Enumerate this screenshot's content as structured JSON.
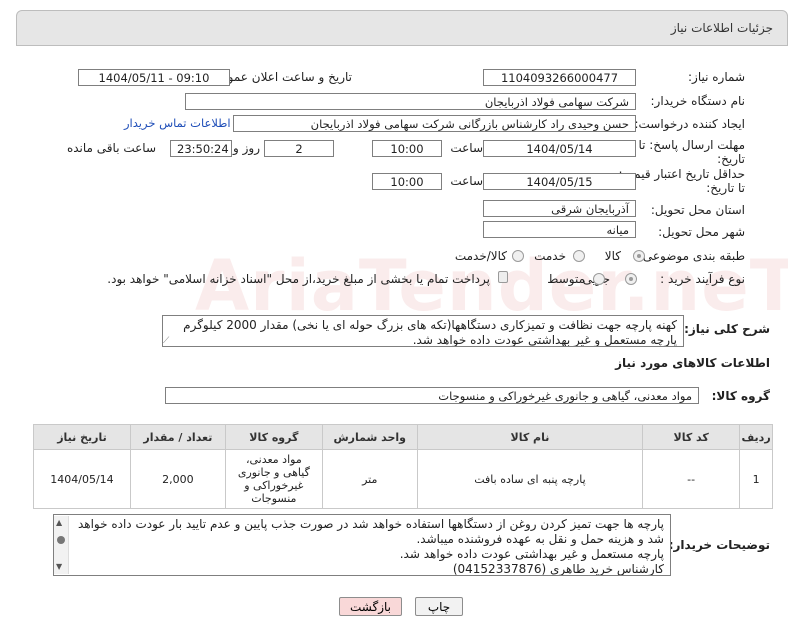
{
  "header": {
    "title": "جزئیات اطلاعات نیاز"
  },
  "fields": {
    "need_number": {
      "label": "شماره نیاز:",
      "value": "1104093266000477"
    },
    "announce_datetime": {
      "label": "تاریخ و ساعت اعلان عمومی:",
      "value": "1404/05/11 - 09:10"
    },
    "buyer_org": {
      "label": "نام دستگاه خریدار:",
      "value": "شرکت سهامی فولاد اذربایجان"
    },
    "requester": {
      "label": "ایجاد کننده درخواست:",
      "value": "حسن وحیدی راد کارشناس بازرگانی شرکت سهامی فولاد اذربایجان"
    },
    "contact_link": "اطلاعات تماس خریدار",
    "response_deadline": {
      "label_line1": "مهلت ارسال پاسخ: تا",
      "label_line2": "تاریخ:",
      "date": "1404/05/14",
      "time_label": "ساعت",
      "time": "10:00",
      "days": "2",
      "days_label": "روز و",
      "remaining": "23:50:24",
      "remaining_label": "ساعت باقی مانده"
    },
    "price_validity": {
      "label_line1": "حداقل تاریخ اعتبار قیمت:",
      "label_line2": "تا تاریخ:",
      "date": "1404/05/15",
      "time_label": "ساعت",
      "time": "10:00"
    },
    "delivery_province": {
      "label": "استان محل تحویل:",
      "value": "آذربایجان شرقی"
    },
    "delivery_city": {
      "label": "شهر محل تحویل:",
      "value": "میانه"
    },
    "category": {
      "label": "طبقه بندی موضوعی:",
      "options": [
        "کالا",
        "خدمت",
        "کالا/خدمت"
      ],
      "selected": "کالا"
    },
    "purchase_type": {
      "label": "نوع فرآیند خرید :",
      "options": [
        "جزیی",
        "متوسط"
      ],
      "selected": "جزیی",
      "payment_note": "پرداخت تمام یا بخشی از مبلغ خرید،از محل \"اسناد خزانه اسلامی\" خواهد بود."
    }
  },
  "description": {
    "label": "شرح کلی نیاز:",
    "lines": [
      "کهنه پارچه جهت نظافت و تمیزکاری  دستگاهها(تکه های بزرگ حوله ای یا نخی) مقدار 2000 کیلوگرم",
      "پارچه مستعمل و غیر بهداشتی عودت داده خواهد شد."
    ]
  },
  "goods_section": {
    "title": "اطلاعات کالاهای مورد نیاز",
    "group_label": "گروه کالا:",
    "group_value": "مواد معدنی، گیاهی و جانوری غیرخوراکی و منسوجات"
  },
  "table": {
    "headers": [
      "ردیف",
      "کد کالا",
      "نام کالا",
      "واحد شمارش",
      "گروه کالا",
      "تعداد / مقدار",
      "تاریخ نیاز"
    ],
    "rows": [
      {
        "row": "1",
        "code": "--",
        "name": "پارچه پنبه ای ساده بافت",
        "unit": "متر",
        "group": "مواد معدنی، گیاهی و جانوری غیرخوراکی و منسوجات",
        "quantity": "2,000",
        "date": "1404/05/14"
      }
    ]
  },
  "buyer_notes": {
    "label": "توضیحات خریدار:",
    "lines": [
      "پارچه ها جهت تمیز کردن روغن از دستگاهها استفاده خواهد شد در صورت جذب پایین و عدم تایید بار عودت داده خواهد",
      "شد و هزینه حمل و نقل به عهده فروشنده میباشد.",
      "پارچه مستعمل و غیر بهداشتی عودت داده خواهد شد.",
      "کارشناس خرید طاهری (04152337876)"
    ]
  },
  "buttons": {
    "print": "چاپ",
    "back": "بازگشت"
  },
  "watermark": "AriaTender.neT",
  "colors": {
    "link": "#1f4eb8",
    "back_button_bg": "#f9d8d8",
    "header_bg": "#e6e6e6"
  }
}
